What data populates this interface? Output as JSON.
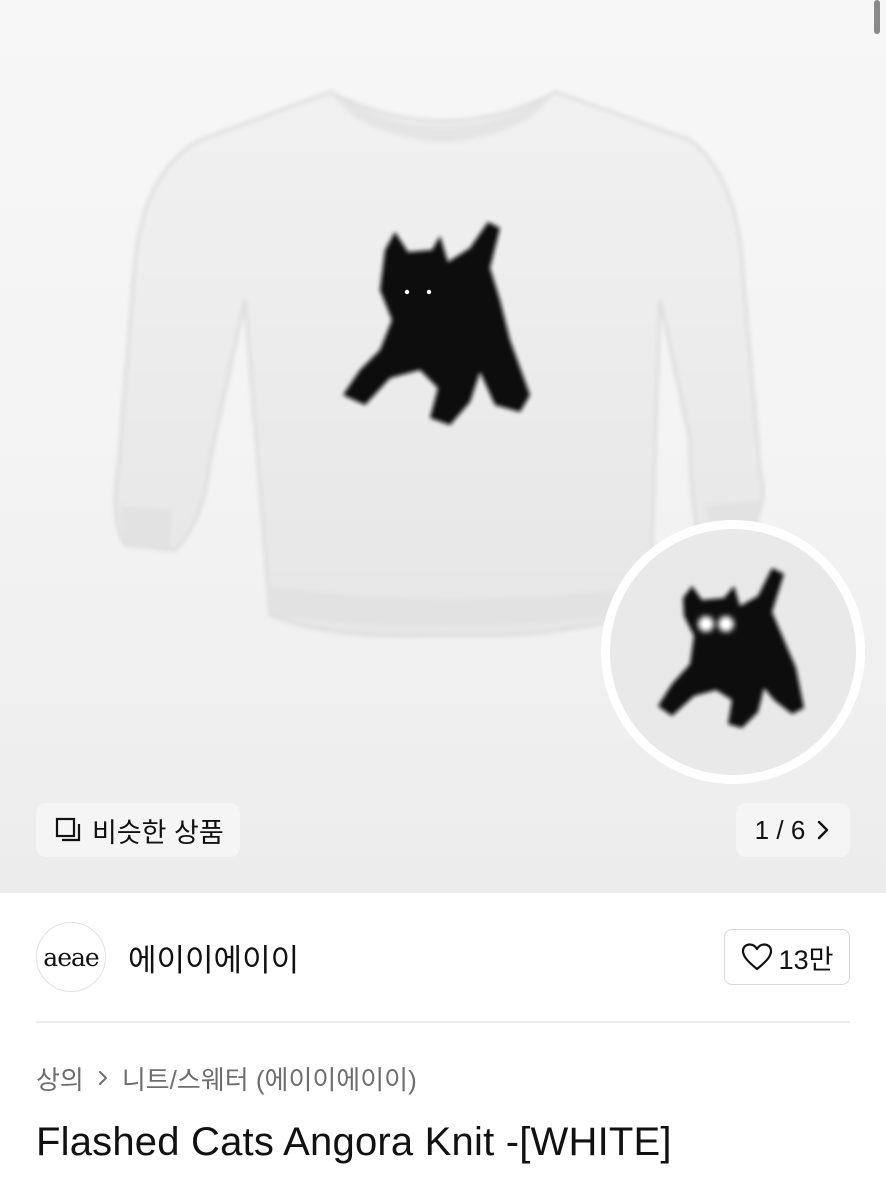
{
  "gallery": {
    "similar_label": "비슷한 상품",
    "pager": {
      "current": "1",
      "separator": "/",
      "total": "6"
    }
  },
  "store": {
    "logo_text": "aeae",
    "name": "에이이에이이",
    "likes": "13만"
  },
  "breadcrumb": {
    "category": "상의",
    "subcategory": "니트/스웨터 (에이이에이이)"
  },
  "product": {
    "title": "Flashed Cats Angora Knit -[WHITE]"
  },
  "colors": {
    "hero_bg": "#f3f3f3",
    "sweater": "#ececec",
    "cat": "#0c0c0c",
    "text_primary": "#111111",
    "text_secondary": "#6e6e6e"
  },
  "icons": {
    "similar": "stacked-squares-icon",
    "pager_next": "chevron-right-icon",
    "like": "heart-outline-icon",
    "breadcrumb_sep": "chevron-right-icon"
  }
}
